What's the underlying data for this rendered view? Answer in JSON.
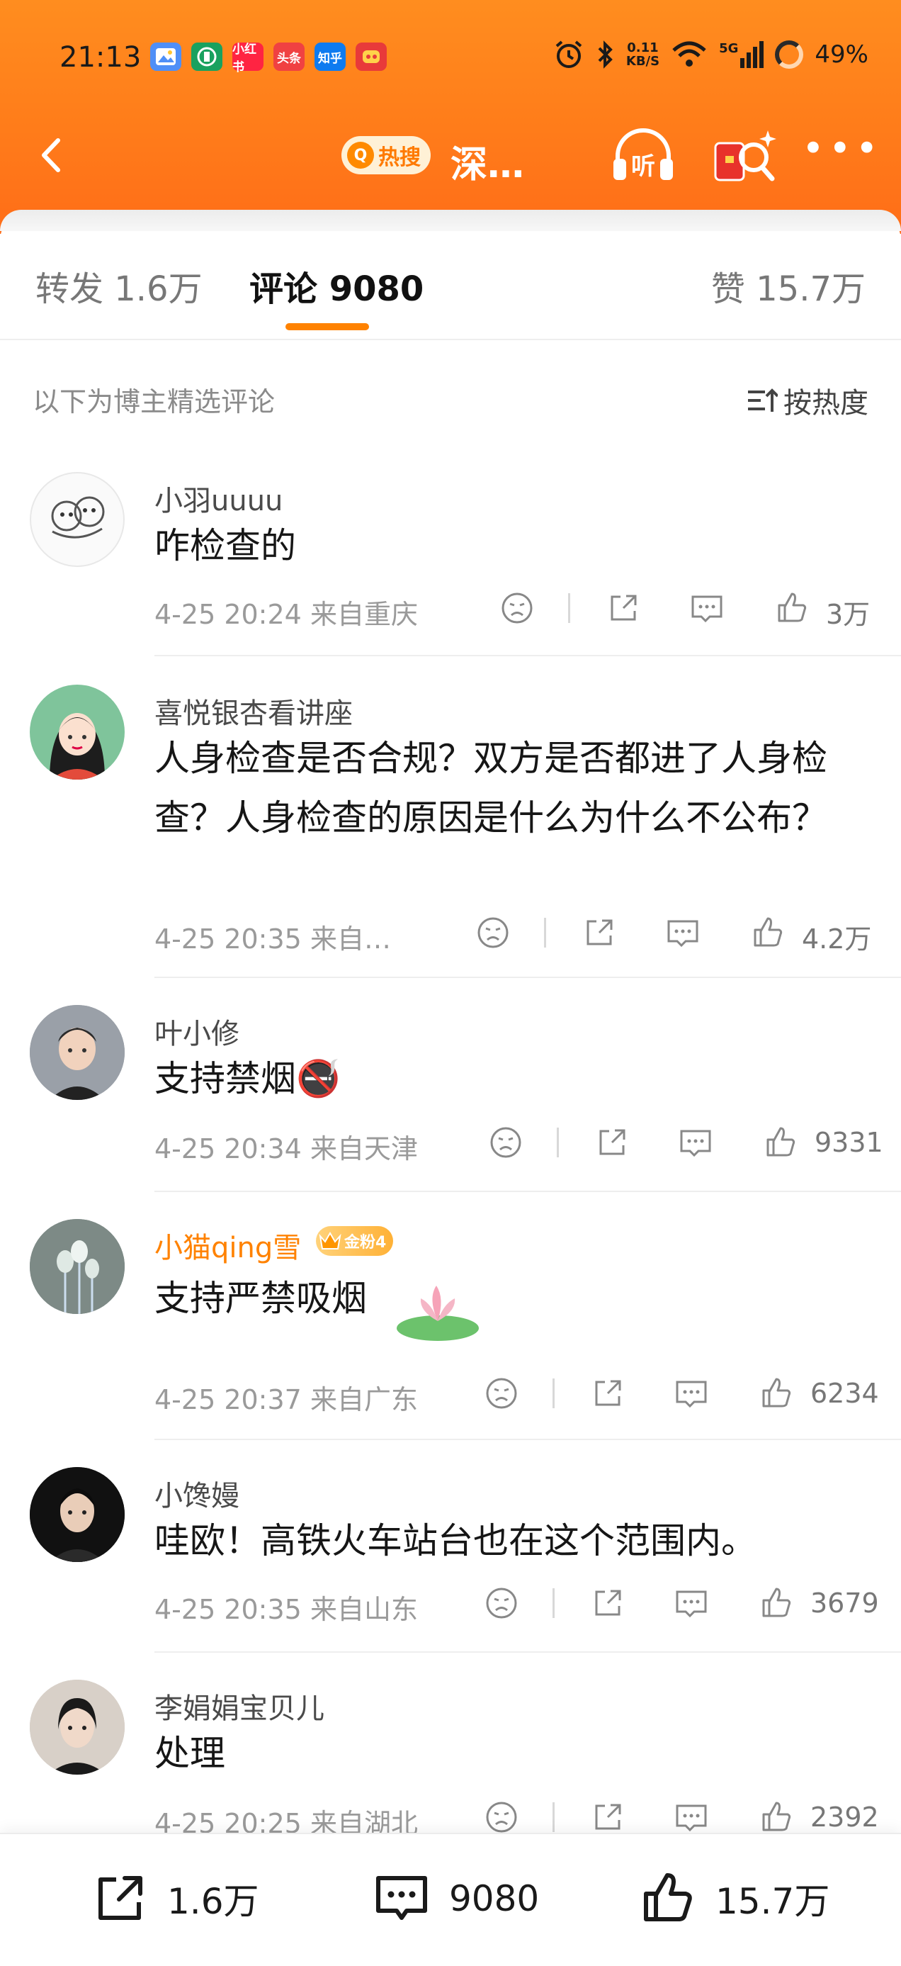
{
  "status_bar": {
    "time": "21:13",
    "app_icons": [
      {
        "name": "gallery-app-icon",
        "label": "",
        "color": "#4f8ff7"
      },
      {
        "name": "bank-app-icon",
        "label": "",
        "color": "#19a15f"
      },
      {
        "name": "xiaohongshu-app-icon",
        "label": "小红书",
        "color": "#ff2442"
      },
      {
        "name": "toutiao-app-icon",
        "label": "头条",
        "color": "#f04142"
      },
      {
        "name": "zhihu-app-icon",
        "label": "知乎",
        "color": "#0e7bf0"
      },
      {
        "name": "game-app-icon",
        "label": "",
        "color": "#e83a3a"
      }
    ],
    "net_speed_value": "0.11",
    "net_speed_unit": "KB/S",
    "signal_label": "5G",
    "battery": "49%"
  },
  "navbar": {
    "hot_badge": "热搜",
    "title": "深…",
    "listen_label": "听"
  },
  "tabs": [
    {
      "label": "转发 1.6万",
      "active": false
    },
    {
      "label": "评论 9080",
      "active": true
    },
    {
      "label": "赞 15.7万",
      "active": false
    }
  ],
  "sort_row": {
    "label": "以下为博主精选评论",
    "button": "按热度"
  },
  "comments": [
    {
      "user": "小羽uuuu",
      "text": "咋检查的",
      "time": "4-25 20:24",
      "location": "来自重庆",
      "likes": "3万"
    },
    {
      "user": "喜悦银杏看讲座",
      "text": "人身检查是否合规？双方是否都进了人身检查？人身检查的原因是什么为什么不公布？",
      "time": "4-25 20:35",
      "location": "来自…",
      "likes": "4.2万"
    },
    {
      "user": "叶小修",
      "text": "支持禁烟",
      "emoji": "🚭",
      "time": "4-25 20:34",
      "location": "来自天津",
      "likes": "9331"
    },
    {
      "user": "小猫qing雪",
      "badge": "金粉4",
      "text": "支持严禁吸烟",
      "time": "4-25 20:37",
      "location": "来自广东",
      "likes": "6234"
    },
    {
      "user": "小馋嫚",
      "text": "哇欧！高铁火车站台也在这个范围内。",
      "time": "4-25 20:35",
      "location": "来自山东",
      "likes": "3679"
    },
    {
      "user": "李娟娟宝贝儿",
      "text": "处理",
      "time": "4-25 20:25",
      "location": "来自湖北",
      "likes": "2392"
    }
  ],
  "bottom_bar": {
    "repost": "1.6万",
    "comment": "9080",
    "like": "15.7万"
  },
  "colors": {
    "header_orange": "#ff7c1a",
    "accent": "#ff8200"
  }
}
